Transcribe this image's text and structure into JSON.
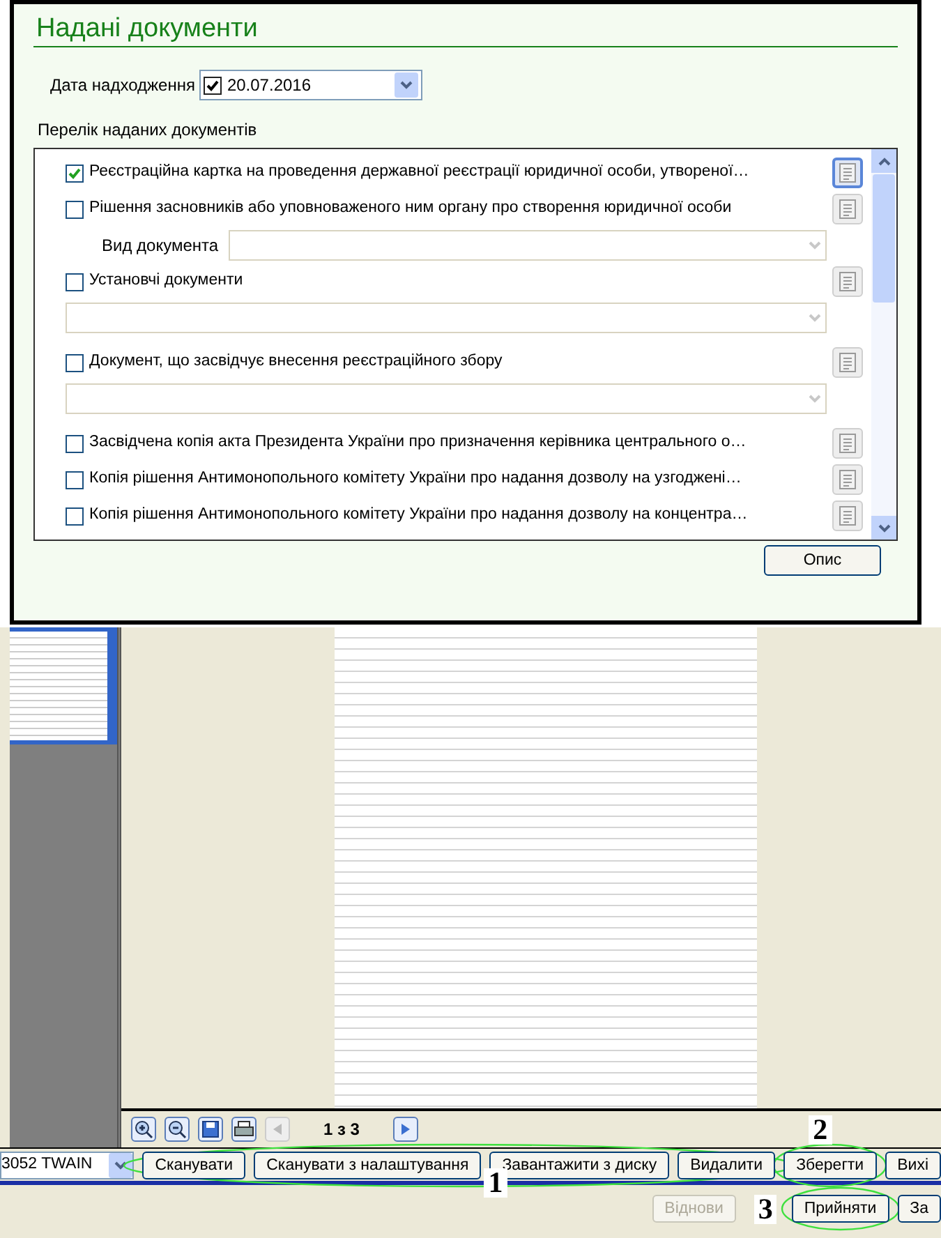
{
  "panel": {
    "title": "Надані документи",
    "date_label": "Дата надходження",
    "date": {
      "checked": true,
      "value": "20.07.2016"
    },
    "list_label": "Перелік наданих документів",
    "documents": [
      {
        "kind": "check",
        "label": "Реєстраційна картка на проведення державної реєстрації юридичної особи, утвореної…",
        "checked": true,
        "selected": true
      },
      {
        "kind": "check",
        "label": "Рішення засновників або уповноваженого ним органу про створення юридичної особи",
        "checked": false,
        "selected": false
      },
      {
        "kind": "subfield",
        "label": "Вид документа"
      },
      {
        "kind": "check",
        "label": "Установчі документи",
        "checked": false,
        "selected": false
      },
      {
        "kind": "combo"
      },
      {
        "kind": "check",
        "label": "Документ, що засвідчує внесення реєстраційного збору",
        "checked": false,
        "selected": false
      },
      {
        "kind": "combo"
      },
      {
        "kind": "check",
        "label": "Засвідчена копія акта Президента України про призначення керівника центрального о…",
        "checked": false,
        "selected": false
      },
      {
        "kind": "check",
        "label": "Копія рішення  Антимонопольного  комітету України про надання дозволу на узгоджені…",
        "checked": false,
        "selected": false
      },
      {
        "kind": "check",
        "label": "Копія рішення  Антимонопольного  комітету України про надання дозволу на концентра…",
        "checked": false,
        "selected": false
      }
    ],
    "describe_button": "Опис"
  },
  "viewer": {
    "page_indicator": "1 з 3"
  },
  "scanner": {
    "device": "3052 TWAIN",
    "buttons": [
      {
        "label": "Сканувати"
      },
      {
        "label": "Сканувати з налаштування"
      },
      {
        "label": "Завантажити з диску"
      },
      {
        "label": "Видалити"
      },
      {
        "label": "Зберегти"
      },
      {
        "label": "Вихі"
      }
    ]
  },
  "actions": [
    {
      "label": "Віднови",
      "disabled": true
    },
    {
      "label": "Прийняти",
      "disabled": false
    },
    {
      "label": "За",
      "disabled": false
    }
  ],
  "annotations": [
    {
      "number": "1"
    },
    {
      "number": "2"
    },
    {
      "number": "3"
    }
  ]
}
